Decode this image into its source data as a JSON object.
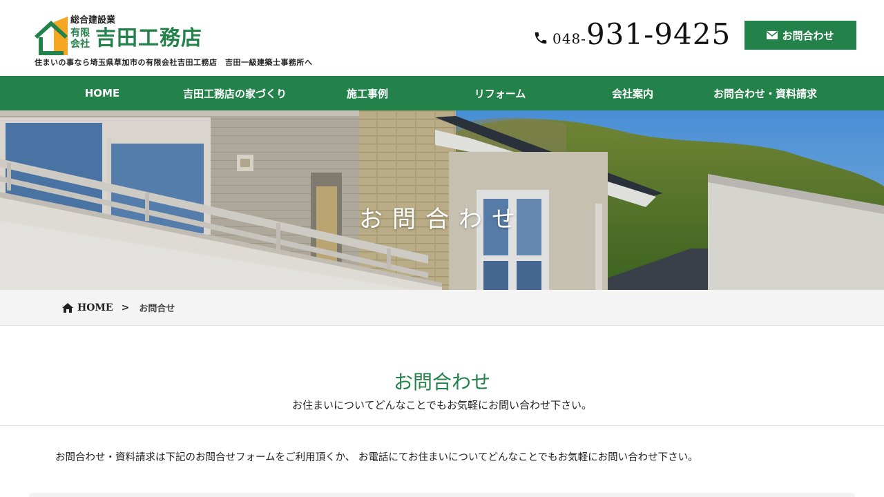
{
  "brand": {
    "small_text": "総合建設業",
    "company_type": "有限会社",
    "name": "吉田工務店",
    "tagline": "住まいの事なら埼玉県草加市の有限会社吉田工務店　吉田一級建築士事務所へ",
    "color": "#22824a",
    "accent": "#f5a623"
  },
  "header": {
    "phone_prefix": "048-",
    "phone_main": "931-9425",
    "phone_icon": "phone-icon",
    "contact_label": "お問合わせ",
    "contact_icon": "envelope-icon"
  },
  "nav": {
    "items": [
      {
        "label": "HOME"
      },
      {
        "label": "吉田工務店の家づくり"
      },
      {
        "label": "施工事例"
      },
      {
        "label": "リフォーム"
      },
      {
        "label": "会社案内"
      },
      {
        "label": "お問合わせ・資料請求"
      }
    ]
  },
  "hero": {
    "title": "お問合わせ"
  },
  "breadcrumb": {
    "home": "HOME",
    "separator": ">",
    "current": "お問合せ",
    "home_icon": "home-icon"
  },
  "main": {
    "heading": "お問合わせ",
    "subheading": "お住まいについてどんなことでもお気軽にお問い合わせ下さい。",
    "intro": "お問合わせ・資料請求は下記のお問合せフォームをご利用頂くか、 お電話にてお住まいについてどんなことでもお気軽にお問い合わせ下さい。"
  }
}
